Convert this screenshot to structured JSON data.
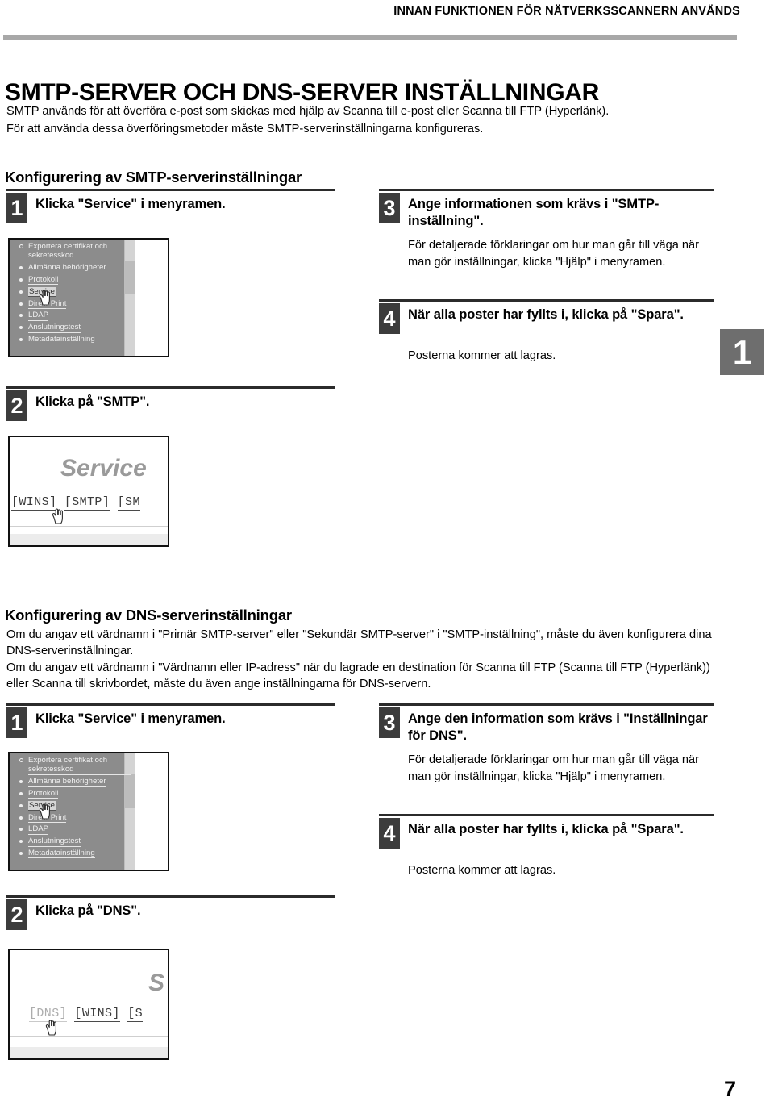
{
  "header": {
    "running_title": "INNAN FUNKTIONEN FÖR NÄTVERKSSCANNERN ANVÄNDS"
  },
  "page_title": "SMTP-SERVER OCH DNS-SERVER INSTÄLLNINGAR",
  "intro": {
    "line1": "SMTP används för att överföra e-post som skickas med hjälp av Scanna till e-post eller Scanna till FTP (Hyperlänk).",
    "line2": "För att använda dessa överföringsmetoder måste SMTP-serverinställningarna konfigureras."
  },
  "smtp_section": {
    "heading": "Konfigurering av SMTP-serverinställningar",
    "steps": {
      "s1": {
        "number": "1",
        "title": "Klicka \"Service\" i menyramen."
      },
      "s2": {
        "number": "2",
        "title": "Klicka på \"SMTP\"."
      },
      "s3": {
        "number": "3",
        "title": "Ange informationen som krävs i \"SMTP-inställning\".",
        "body": "För detaljerade förklaringar om hur man går till väga när man gör inställningar, klicka \"Hjälp\" i menyramen."
      },
      "s4": {
        "number": "4",
        "title": "När alla poster har fyllts i, klicka på \"Spara\".",
        "body": "Posterna kommer att lagras."
      }
    },
    "tab_shot": {
      "title_word": "Service",
      "tabs": [
        "[WINS]",
        "[SMTP]",
        "[SM"
      ]
    }
  },
  "dns_section": {
    "heading": "Konfigurering av DNS-serverinställningar",
    "paragraph1": "Om du angav ett värdnamn i \"Primär SMTP-server\" eller \"Sekundär SMTP-server\" i \"SMTP-inställning\", måste du även konfigurera dina DNS-serverinställningar.",
    "paragraph2": "Om du angav ett värdnamn i \"Värdnamn eller IP-adress\" när du lagrade en destination för Scanna till FTP (Scanna till FTP (Hyperlänk)) eller Scanna till skrivbordet, måste du även ange inställningarna för DNS-servern.",
    "steps": {
      "s1": {
        "number": "1",
        "title": "Klicka \"Service\" i menyramen."
      },
      "s2": {
        "number": "2",
        "title": "Klicka på \"DNS\"."
      },
      "s3": {
        "number": "3",
        "title": "Ange den information som krävs i \"Inställningar för DNS\".",
        "body": "För detaljerade förklaringar om hur man går till väga när man gör inställningar, klicka \"Hjälp\" i menyramen."
      },
      "s4": {
        "number": "4",
        "title": "När alla poster har fyllts i, klicka på \"Spara\".",
        "body": "Posterna kommer att lagras."
      }
    },
    "tab_shot": {
      "title_word": "S",
      "tabs": [
        "[DNS]",
        "[WINS]",
        "[S"
      ]
    }
  },
  "menu_shot": {
    "items": [
      "Exportera certifikat och sekretesskod",
      "Allmänna behörigheter",
      "Protokoll",
      "Service",
      "Direkt Print",
      "LDAP",
      "Anslutningstest",
      "Metadatainställning"
    ],
    "selected": "Service"
  },
  "chapter_tab": "1",
  "folio": "7",
  "colors": {
    "header_rule": "#a8a8a8",
    "step_badge": "#3c3c3c",
    "step_rule": "#2b2b2b",
    "chapter_tab": "#6e6e6e",
    "menu_pane": "#8c8c8c"
  }
}
